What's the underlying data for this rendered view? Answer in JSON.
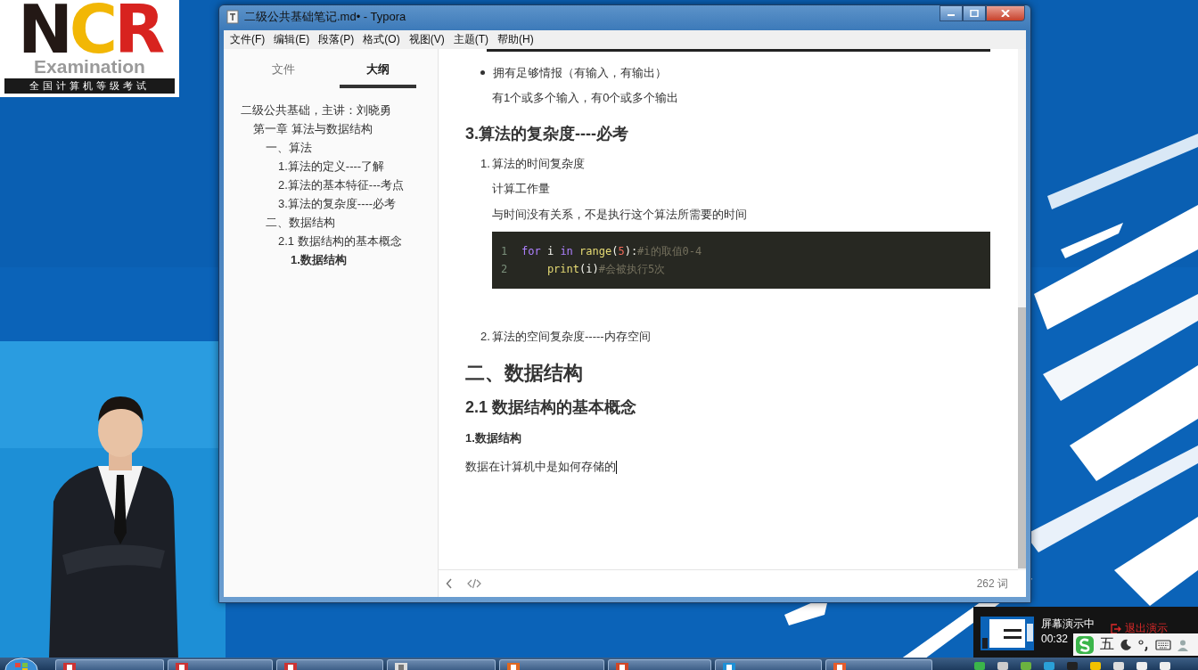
{
  "logo": {
    "letters": [
      {
        "text": "N",
        "color": "#231815"
      },
      {
        "text": "C",
        "color": "#f2b705"
      },
      {
        "text": "R",
        "color": "#d8231f"
      }
    ],
    "name": "Examination",
    "tagline": "全国计算机等级考试"
  },
  "window": {
    "title": "二级公共基础笔记.md• - Typora"
  },
  "menu": [
    "文件(F)",
    "编辑(E)",
    "段落(P)",
    "格式(O)",
    "视图(V)",
    "主题(T)",
    "帮助(H)"
  ],
  "sidebar": {
    "tabs": [
      {
        "label": "文件",
        "selected": false
      },
      {
        "label": "大纲",
        "selected": true
      }
    ],
    "outline": [
      {
        "text": "二级公共基础，主讲：刘晓勇",
        "selected": false,
        "children": [
          {
            "text": "第一章 算法与数据结构",
            "selected": false,
            "children": [
              {
                "text": "一、算法",
                "selected": false,
                "children": [
                  {
                    "text": "1.算法的定义----了解",
                    "selected": false
                  },
                  {
                    "text": "2.算法的基本特征---考点",
                    "selected": false
                  },
                  {
                    "text": "3.算法的复杂度----必考",
                    "selected": false
                  }
                ]
              },
              {
                "text": "二、数据结构",
                "selected": false,
                "children": [
                  {
                    "text": "2.1 数据结构的基本概念",
                    "selected": false,
                    "children": [
                      {
                        "text": "1.数据结构",
                        "selected": true
                      }
                    ]
                  }
                ]
              }
            ]
          }
        ]
      }
    ]
  },
  "document": {
    "blocks": [
      {
        "kind": "rule"
      },
      {
        "kind": "bullet",
        "text": "拥有足够情报（有输入，有输出）"
      },
      {
        "kind": "indented",
        "text": "有1个或多个输入，有0个或多个输出"
      },
      {
        "kind": "h3",
        "text": "3.算法的复杂度----必考"
      },
      {
        "kind": "numbered",
        "number": "1.",
        "text": "算法的时间复杂度"
      },
      {
        "kind": "indented",
        "text": "计算工作量"
      },
      {
        "kind": "indented",
        "text": "与时间没有关系，不是执行这个算法所需要的时间"
      },
      {
        "kind": "code",
        "lines": [
          {
            "number": "1",
            "tokens": [
              {
                "kind": "keyword",
                "text": "for"
              },
              {
                "kind": "plain",
                "text": " i "
              },
              {
                "kind": "keyword",
                "text": "in"
              },
              {
                "kind": "builtin",
                "text": " range"
              },
              {
                "kind": "plain",
                "text": "("
              },
              {
                "kind": "number",
                "text": "5"
              },
              {
                "kind": "plain",
                "text": "):"
              },
              {
                "kind": "comment",
                "text": "#i的取值0-4"
              }
            ]
          },
          {
            "number": "2",
            "tokens": [
              {
                "kind": "builtin",
                "text": "    print"
              },
              {
                "kind": "plain",
                "text": "(i)"
              },
              {
                "kind": "comment",
                "text": "#会被执行5次"
              }
            ]
          }
        ]
      },
      {
        "kind": "numbered",
        "number": "2.",
        "text": "算法的空间复杂度-----内存空间"
      },
      {
        "kind": "h1",
        "text": "二、数据结构"
      },
      {
        "kind": "h2",
        "text": "2.1 数据结构的基本概念"
      },
      {
        "kind": "h4",
        "text": "1.数据结构"
      },
      {
        "kind": "para",
        "text": "数据在计算机中是如何存储的",
        "cursor": true
      }
    ]
  },
  "footer": {
    "word_count": "262 词"
  },
  "recording": {
    "status": "屏幕演示中",
    "time": "00:32",
    "exit": "退出演示"
  },
  "ime": {
    "mode": "五"
  }
}
